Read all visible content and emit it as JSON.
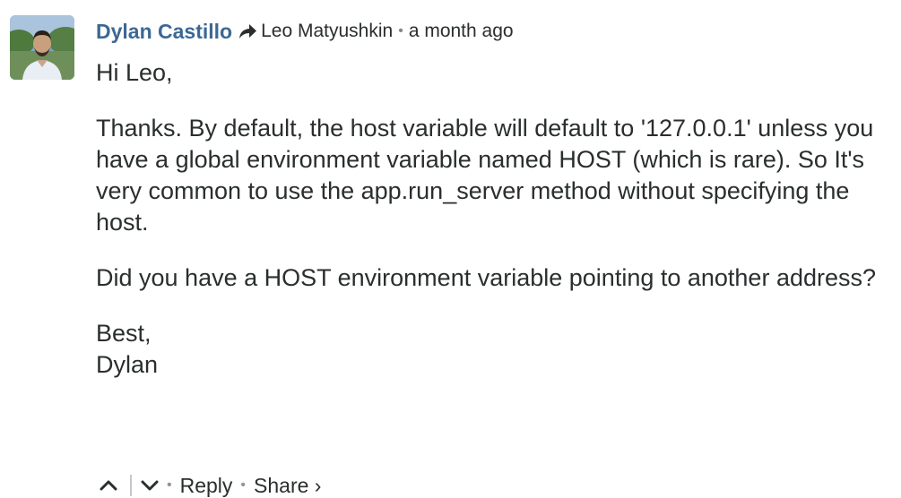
{
  "comment": {
    "author": "Dylan Castillo",
    "recipient": "Leo Matyushkin",
    "separator": "•",
    "time": "a month ago",
    "paragraphs": [
      "Hi Leo,",
      "Thanks. By default, the host variable will default to '127.0.0.1' unless you have a global environment variable named HOST (which is rare). So It's very common to use the app.run_server method without specifying the host.",
      "Did you have a HOST environment variable pointing to another address?"
    ],
    "signoff": [
      "Best,",
      "Dylan"
    ],
    "actions": {
      "upvote_icon": "chevron-up-icon",
      "downvote_icon": "chevron-down-icon",
      "dot": "•",
      "reply": "Reply",
      "share": "Share ›"
    },
    "colors": {
      "author": "#3c6894",
      "text": "#2a2e2e",
      "muted": "#7e8a94"
    }
  }
}
